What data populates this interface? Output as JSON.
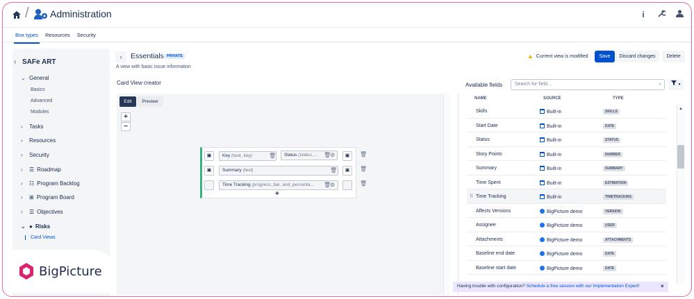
{
  "app": {
    "title": "Administration"
  },
  "tabs": [
    {
      "label": "Box types",
      "active": true
    },
    {
      "label": "Resources",
      "active": false
    },
    {
      "label": "Security",
      "active": false
    }
  ],
  "sidebar": {
    "title": "SAFe ART",
    "general": {
      "label": "General",
      "subitems": [
        "Basics",
        "Advanced",
        "Modules"
      ]
    },
    "items": [
      "Tasks",
      "Resources",
      "Security",
      "Roadmap",
      "Program Backlog",
      "Program Board",
      "Objectives"
    ],
    "risks": {
      "label": "Risks",
      "subitem": "Card Views"
    }
  },
  "logo": {
    "text": "BigPicture",
    "color": "#d9236e"
  },
  "view": {
    "title": "Essentials",
    "badge": "PRIVATE",
    "description": "A view with basic issue information",
    "warning": "Current view is modified",
    "save": "Save",
    "discard": "Discard changes",
    "delete": "Delete"
  },
  "creator": {
    "label": "Card View creator",
    "edit": "Edit",
    "preview": "Preview",
    "zoom_in": "+",
    "zoom_out": "−",
    "fields": {
      "key": {
        "name": "Key",
        "id": "(task_key)"
      },
      "status": {
        "name": "Status",
        "id": "(status_..."
      },
      "summary": {
        "name": "Summary",
        "id": "(text)"
      },
      "time_tracking": {
        "name": "Time Tracking",
        "id": "(progress_bar_and_percenta..."
      }
    },
    "add": "+"
  },
  "available": {
    "label": "Available fields",
    "search_placeholder": "Search for field...",
    "filter": "▼",
    "columns": {
      "name": "NAME",
      "source": "SOURCE",
      "type": "TYPE"
    },
    "rows": [
      {
        "name": "Skills",
        "source": "Built-in",
        "type": "SKILLS",
        "src": "bi"
      },
      {
        "name": "Start Date",
        "source": "Built-in",
        "type": "DATE",
        "src": "bi"
      },
      {
        "name": "Status",
        "source": "Built-in",
        "type": "STATUS",
        "src": "bi"
      },
      {
        "name": "Story Points",
        "source": "Built-in",
        "type": "NUMBER",
        "src": "bi"
      },
      {
        "name": "Summary",
        "source": "Built-in",
        "type": "SUMMARY",
        "src": "bi"
      },
      {
        "name": "Time Spent",
        "source": "Built-in",
        "type": "ESTIMATION",
        "src": "bi"
      },
      {
        "name": "Time Tracking",
        "source": "Built-in",
        "type": "TIMETRACKING",
        "src": "bi",
        "highlighted": true
      },
      {
        "name": "Affects Versions",
        "source": "BigPicture demo",
        "type": "VERSION",
        "src": "bp"
      },
      {
        "name": "Assignee",
        "source": "BigPicture demo",
        "type": "USER",
        "src": "bp"
      },
      {
        "name": "Attachments",
        "source": "BigPicture demo",
        "type": "ATTACHMENTS",
        "src": "bp"
      },
      {
        "name": "Baseline end date",
        "source": "BigPicture demo",
        "type": "DATE",
        "src": "bp"
      },
      {
        "name": "Baseline start date",
        "source": "BigPicture demo",
        "type": "DATE",
        "src": "bp"
      }
    ]
  },
  "banner": {
    "text": "Having trouble with configuration?",
    "link": "Schedule a free session with our Implementation Expert!",
    "close": "×"
  }
}
